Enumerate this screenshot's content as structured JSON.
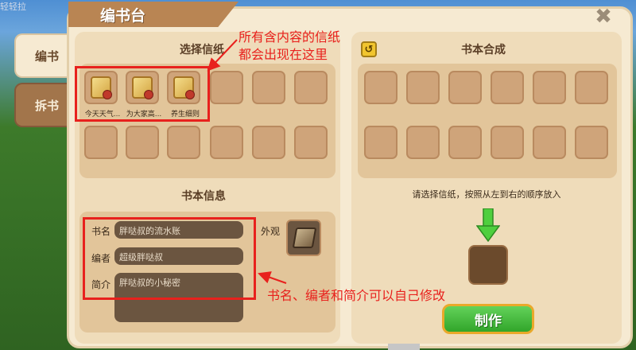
{
  "corner_label": "轻轻拉",
  "window": {
    "title": "编书台",
    "close_icon": "✖"
  },
  "side_tabs": [
    {
      "label": "编书",
      "active": true
    },
    {
      "label": "拆书",
      "active": false
    }
  ],
  "left_panel": {
    "select_title": "选择信纸",
    "letters": [
      {
        "label": "今天天气..."
      },
      {
        "label": "为大家高..."
      },
      {
        "label": "养生细则"
      }
    ],
    "info_title": "书本信息",
    "fields": [
      {
        "label": "书名",
        "value": "胖哒叔的流水账"
      },
      {
        "label": "编者",
        "value": "超级胖哒叔"
      },
      {
        "label": "简介",
        "value": "胖哒叔的小秘密"
      }
    ],
    "cover_label": "外观"
  },
  "right_panel": {
    "title": "书本合成",
    "hint": "请选择信纸，按照从左到右的顺序放入",
    "make_button": "制作"
  },
  "annotations": {
    "top_line1": "所有含内容的信纸",
    "top_line2": "都会出现在这里",
    "bottom": "书名、编者和简介可以自己修改",
    "color": "#e8211d"
  },
  "colors": {
    "panel": "#efdcba",
    "slot": "#cfa47a",
    "accent_button": "#31a52a"
  }
}
